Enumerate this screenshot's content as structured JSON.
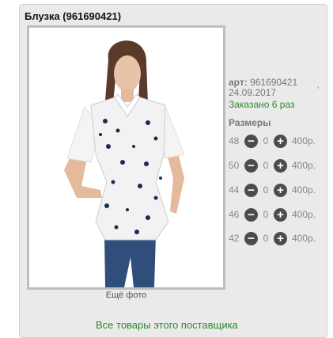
{
  "product": {
    "title": "Блузка (961690421)",
    "article_label": "арт:",
    "article_value": "961690421",
    "tick_mark": "’",
    "date": "24.09.2017",
    "ordered": "Заказано 6 раз",
    "sizes_title": "Размеры",
    "more_photo": "Ещё фото",
    "supplier_link": "Все товары этого поставщика"
  },
  "sizes": [
    {
      "size": "48",
      "qty": "0",
      "price": "400р."
    },
    {
      "size": "50",
      "qty": "0",
      "price": "400р."
    },
    {
      "size": "44",
      "qty": "0",
      "price": "400р."
    },
    {
      "size": "46",
      "qty": "0",
      "price": "400р."
    },
    {
      "size": "42",
      "qty": "0",
      "price": "400р."
    }
  ],
  "icons": {
    "minus": "−",
    "plus": "+"
  },
  "colors": {
    "accent_green": "#2b8a2b",
    "button_gray": "#4c4c4c",
    "card_bg": "#eaeaea"
  }
}
